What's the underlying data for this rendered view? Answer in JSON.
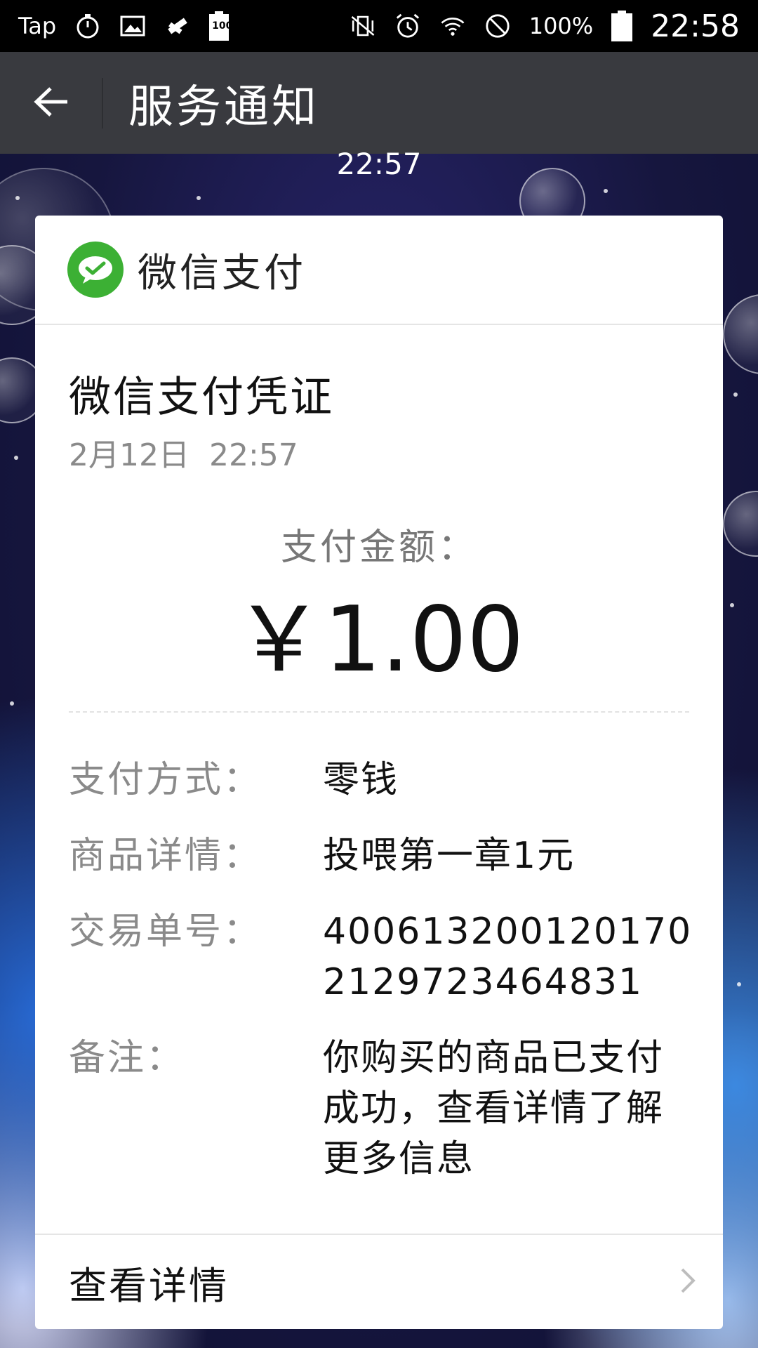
{
  "status_bar": {
    "app_label": "Tap",
    "battery_box_label": "100",
    "battery_percent": "100%",
    "time": "22:58"
  },
  "title_bar": {
    "title": "服务通知"
  },
  "chat": {
    "timestamp": "22:57"
  },
  "card": {
    "brand": "微信支付",
    "receipt_title": "微信支付凭证",
    "date": "2月12日  22:57",
    "amount_label": "支付金额：",
    "amount_value": "￥1.00",
    "details": [
      {
        "label": "支付方式：",
        "value": "零钱"
      },
      {
        "label": "商品详情：",
        "value": "投喂第一章1元"
      },
      {
        "label": "交易单号：",
        "value": "4006132001201702129723464831"
      },
      {
        "label": "备注：",
        "value": "你购买的商品已支付成功，查看详情了解更多信息"
      }
    ],
    "footer_label": "查看详情"
  },
  "colors": {
    "status_bar": "#000000",
    "title_bar": "#393a3f",
    "wechat_green": "#3cb034",
    "card": "#ffffff"
  },
  "icons": {
    "back": "arrow-left-icon",
    "brand": "wechat-pay-icon",
    "footer": "chevron-right-icon"
  }
}
